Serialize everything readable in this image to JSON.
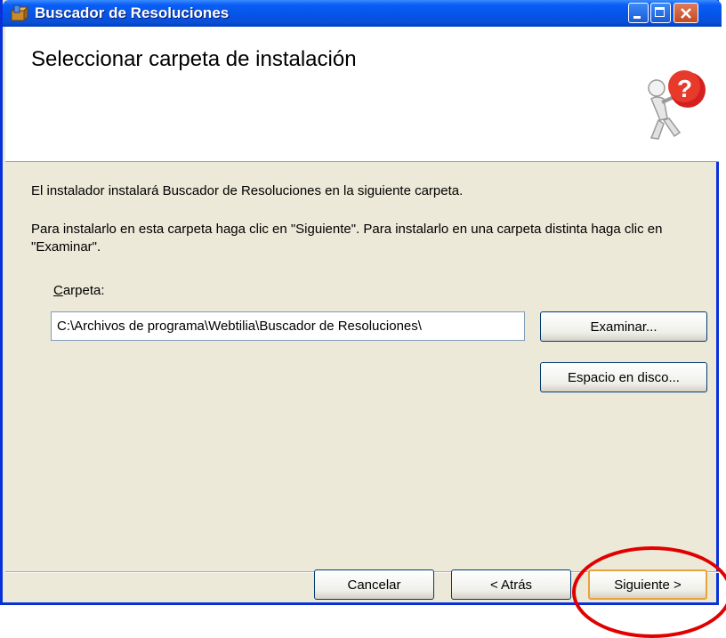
{
  "window": {
    "title": "Buscador de Resoluciones",
    "title_icon": "installer-box-icon",
    "controls": [
      "minimize-icon",
      "maximize-icon",
      "close-icon"
    ]
  },
  "banner": {
    "title": "Seleccionar carpeta de instalación",
    "graphic": "question-person-icon"
  },
  "body": {
    "line1": "El instalador instalará Buscador de Resoluciones en la siguiente carpeta.",
    "line2": "Para instalarlo en esta carpeta haga clic en \"Siguiente\". Para instalarlo en una carpeta distinta haga clic en \"Examinar\".",
    "folder_label_first": "C",
    "folder_label_rest": "arpeta:",
    "folder_value": "C:\\Archivos de programa\\Webtilia\\Buscador de Resoluciones\\",
    "browse_label": "Examinar...",
    "disk_space_label": "Espacio en disco..."
  },
  "footer": {
    "cancel_label": "Cancelar",
    "back_label": "< Atrás",
    "next_label": "Siguiente >"
  },
  "colors": {
    "titlebar": "#0554e8",
    "dialog_bg": "#ece9d8",
    "highlight": "#e00000"
  }
}
